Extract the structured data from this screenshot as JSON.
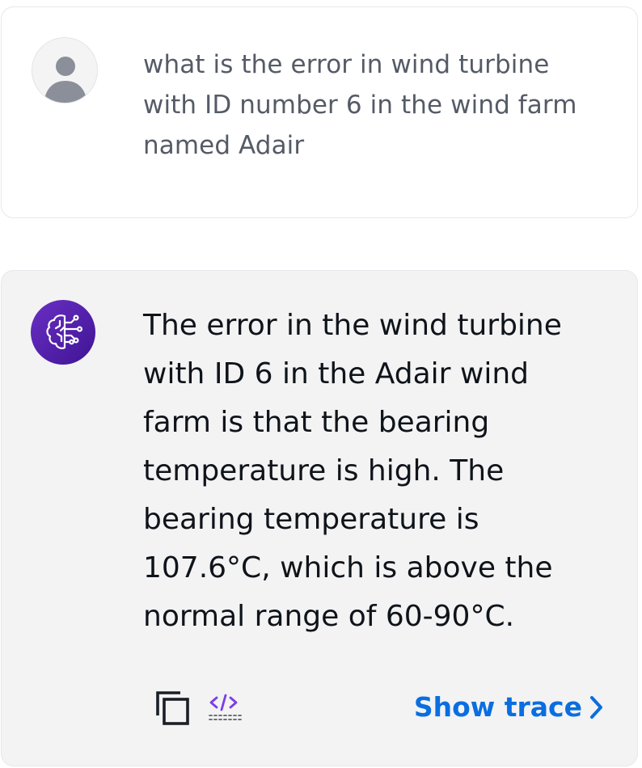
{
  "user_message": {
    "avatar_icon": "user-silhouette-icon",
    "text": "what is the error in wind turbine with ID number 6 in the wind farm named Adair"
  },
  "assistant_message": {
    "avatar_icon": "ai-brain-circuit-icon",
    "text": "The error in the wind turbine with ID 6 in the Adair wind farm is that the bearing temperature is high. The bearing temperature is 107.6°C, which is above the normal range of 60-90°C.",
    "actions": {
      "copy_icon": "copy-icon",
      "code_icon": "code-icon",
      "show_trace_label": "Show trace",
      "show_trace_icon": "chevron-right-icon"
    }
  },
  "colors": {
    "link": "#0a6ee0",
    "assistant_bg": "#f3f3f4",
    "bot_avatar": "#5a23b5",
    "code_icon": "#7b3fe4"
  }
}
